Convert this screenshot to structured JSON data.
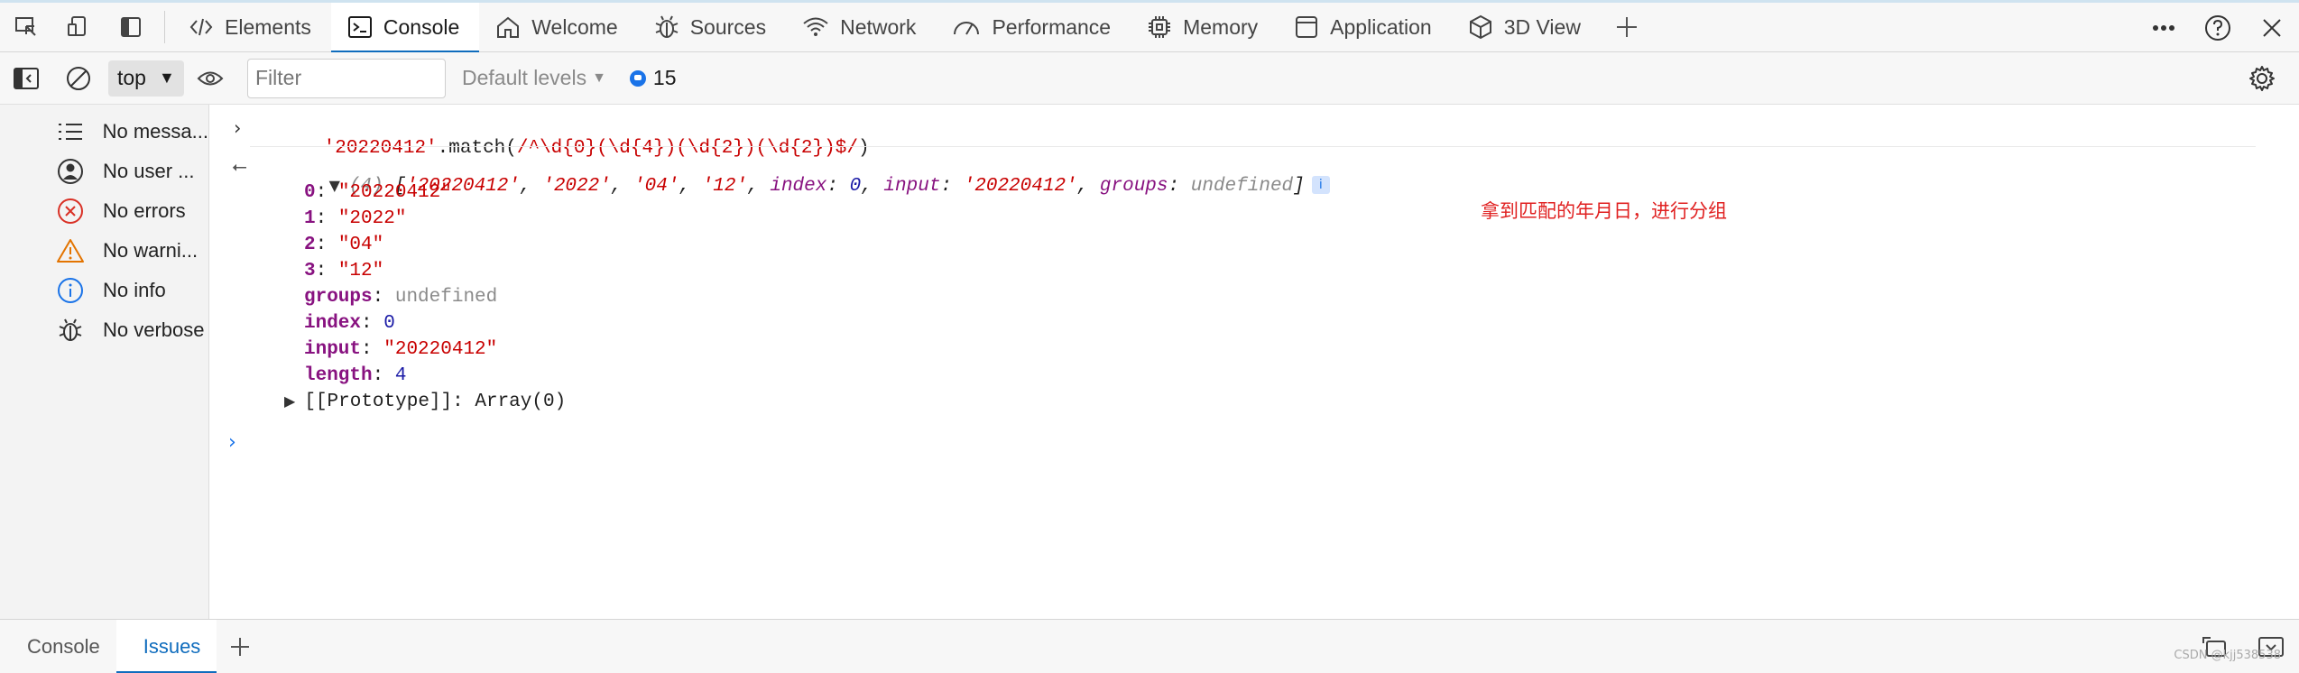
{
  "tabs": [
    {
      "label": "Elements",
      "icon": "elements-icon"
    },
    {
      "label": "Console",
      "icon": "console-icon"
    },
    {
      "label": "Welcome",
      "icon": "welcome-icon"
    },
    {
      "label": "Sources",
      "icon": "sources-icon"
    },
    {
      "label": "Network",
      "icon": "network-icon"
    },
    {
      "label": "Performance",
      "icon": "performance-icon"
    },
    {
      "label": "Memory",
      "icon": "memory-icon"
    },
    {
      "label": "Application",
      "icon": "application-icon"
    },
    {
      "label": "3D View",
      "icon": "3d-view-icon"
    }
  ],
  "active_tab": "Console",
  "toolbar": {
    "context": "top",
    "filter_placeholder": "Filter",
    "levels": "Default levels",
    "issues_count": "15"
  },
  "sidebar": {
    "items": [
      {
        "label": "No messa...",
        "icon": "list-icon"
      },
      {
        "label": "No user ...",
        "icon": "user-icon"
      },
      {
        "label": "No errors",
        "icon": "error-icon"
      },
      {
        "label": "No warni...",
        "icon": "warning-icon"
      },
      {
        "label": "No info",
        "icon": "info-icon"
      },
      {
        "label": "No verbose",
        "icon": "bug-icon"
      }
    ]
  },
  "console": {
    "input": {
      "string": "'20220412'",
      "method": ".match(",
      "regex": "/^\\d{0}(\\d{4})(\\d{2})(\\d{2})$/",
      "close": ")"
    },
    "result_summary": {
      "count": "(4)",
      "items": [
        "'20220412'",
        "'2022'",
        "'04'",
        "'12'"
      ],
      "index_key": "index",
      "index_val": "0",
      "input_key": "input",
      "input_val": "'20220412'",
      "groups_key": "groups",
      "groups_val": "undefined",
      "info_badge": "i"
    },
    "entries": [
      {
        "key": "0",
        "value": "\"20220412\"",
        "kind": "str"
      },
      {
        "key": "1",
        "value": "\"2022\"",
        "kind": "str"
      },
      {
        "key": "2",
        "value": "\"04\"",
        "kind": "str"
      },
      {
        "key": "3",
        "value": "\"12\"",
        "kind": "str"
      },
      {
        "key": "groups",
        "value": "undefined",
        "kind": "undef"
      },
      {
        "key": "index",
        "value": "0",
        "kind": "num"
      },
      {
        "key": "input",
        "value": "\"20220412\"",
        "kind": "str"
      },
      {
        "key": "length",
        "value": "4",
        "kind": "num"
      }
    ],
    "prototype": {
      "key": "[[Prototype]]",
      "value": "Array(0)"
    },
    "annotation": "拿到匹配的年月日，进行分组"
  },
  "drawer": {
    "tabs": [
      "Console",
      "Issues"
    ],
    "active": "Issues",
    "watermark": "CSDN @kjj538538"
  },
  "colors": {
    "accent": "#0f6cbd",
    "string": "#c80000",
    "keyword": "#881280",
    "number": "#1a1aa6",
    "annotation": "#e02020"
  }
}
